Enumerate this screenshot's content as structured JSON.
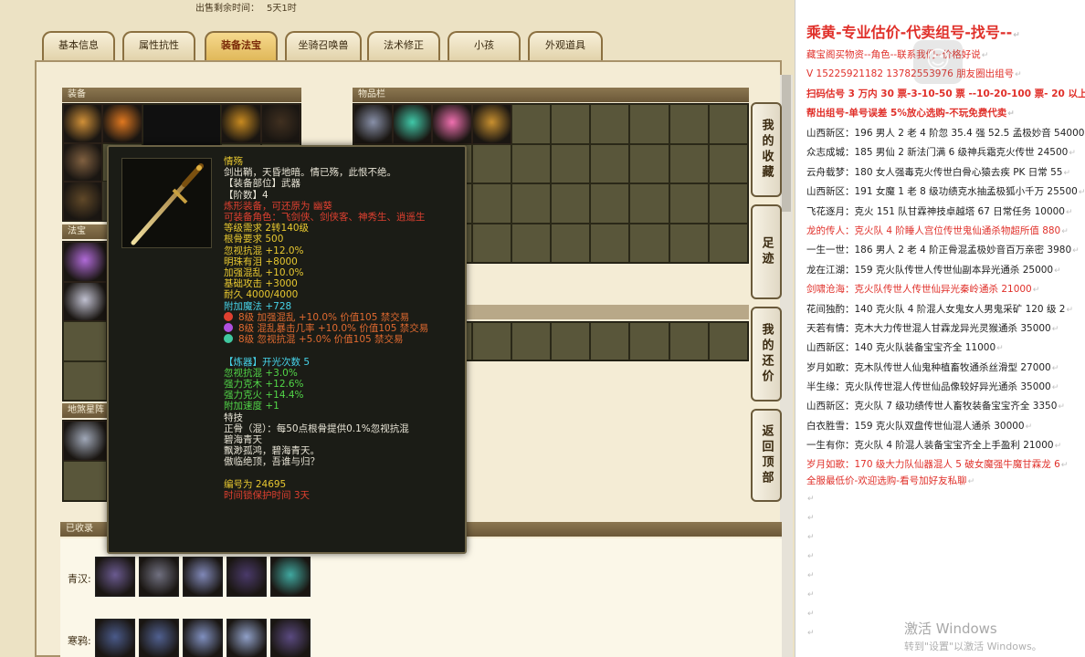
{
  "header": {
    "sale_time_label": "出售剩余时间：",
    "sale_time_value": "5天1时"
  },
  "tabs": [
    "基本信息",
    "属性抗性",
    "装备法宝",
    "坐骑召唤兽",
    "法术修正",
    "小孩",
    "外观道具"
  ],
  "active_tab": "装备法宝",
  "panels": {
    "equip": "装备",
    "inventory": "物品栏",
    "fabao": "法宝",
    "dijiang": "地煞星阵",
    "collected": "已收录"
  },
  "side_buttons": [
    "我的收藏",
    "足迹",
    "我的还价",
    "返回顶部"
  ],
  "collected_rows": [
    {
      "label": "青汉:"
    },
    {
      "label": "寒鸦:"
    }
  ],
  "tooltip": {
    "name": "情殇",
    "lines": [
      {
        "text": "剑出鞘，天昏地暗。情已殇，此恨不绝。",
        "color": "w"
      },
      {
        "text": "【装备部位】武器",
        "color": "w"
      },
      {
        "text": "【阶数】4",
        "color": "w"
      },
      {
        "text": "炼形装备，可还原为   幽葵",
        "color": "r"
      },
      {
        "text": "可装备角色：飞剑侠、剑侠客、神秀生、逍遥生",
        "color": "r"
      },
      {
        "text": "等级需求 2转140级",
        "color": "y"
      },
      {
        "text": "根骨要求 500",
        "color": "y"
      },
      {
        "text": "忽视抗混 +12.0%",
        "color": "y"
      },
      {
        "text": "明珠有泪 +8000",
        "color": "y"
      },
      {
        "text": "加强混乱 +10.0%",
        "color": "y"
      },
      {
        "text": "基础攻击 +3000",
        "color": "y"
      },
      {
        "text": "耐久 4000/4000",
        "color": "y"
      },
      {
        "text": "附加魔法 +728",
        "color": "c"
      },
      {
        "text": "8级 加强混乱 +10.0% 价值105 禁交易",
        "color": "o",
        "gem": "#e04030"
      },
      {
        "text": "8级 混乱暴击几率 +10.0% 价值105 禁交易",
        "color": "o",
        "gem": "#b050e0"
      },
      {
        "text": "8级 忽视抗混 +5.0% 价值105 禁交易",
        "color": "o",
        "gem": "#40c8a0"
      },
      {
        "text": "",
        "color": "w"
      },
      {
        "text": "【炼器】开光次数 5",
        "color": "c"
      },
      {
        "text": "忽视抗混 +3.0%",
        "color": "g"
      },
      {
        "text": "强力克木 +12.6%",
        "color": "g"
      },
      {
        "text": "强力克火 +14.4%",
        "color": "g"
      },
      {
        "text": "附加速度 +1",
        "color": "g"
      },
      {
        "text": "特技",
        "color": "w"
      },
      {
        "text": "正骨（混）：每50点根骨提供0.1%忽视抗混",
        "color": "w"
      },
      {
        "text": "碧海青天",
        "color": "w"
      },
      {
        "text": "飘渺孤鸿，碧海青天。",
        "color": "w"
      },
      {
        "text": "傲临绝顶，吾谁与归？",
        "color": "w"
      },
      {
        "text": "",
        "color": "w"
      },
      {
        "text": "编号为 24695",
        "color": "y"
      },
      {
        "text": "时间锁保护时间   3天",
        "color": "r"
      }
    ]
  },
  "doc": {
    "lines": [
      {
        "text": "乘黄-专业估价-代卖组号-找号--",
        "style": "big"
      },
      {
        "text": "藏宝阁买物资--角色--联系我们--价格好说",
        "style": "red"
      },
      {
        "text": "V 15225921182   13782553976 朋友圈出组号",
        "style": "red"
      },
      {
        "text": "扫码估号 3 万内 30 票-3-10-50 票 --10-20-100 票- 20 以上 1",
        "style": "red bold"
      },
      {
        "text": "帮出组号-单号误差 5%放心选购-不玩免费代卖",
        "style": "red bold"
      },
      {
        "text": "山西新区：196 男人 2 老 4 阶忽 35.4 强 52.5 孟极妙音 54000",
        "style": ""
      },
      {
        "text": "众志成城：185 男仙 2 新法门满 6 级神兵霜克火传世 24500",
        "style": ""
      },
      {
        "text": "云舟载梦：180 女人强毒克火传世白骨心猿去疾 PK 日常 55",
        "style": ""
      },
      {
        "text": "山西新区：191 女魔 1 老 8 级功绩克水抽孟极狐小千万 25500",
        "style": ""
      },
      {
        "text": "飞花逐月：克火 151 队甘霖神技卓越塔 67 日常任务 10000",
        "style": ""
      },
      {
        "text": "龙的传人：克火队 4 阶睡人宫位传世鬼仙通杀物超所值 880",
        "style": "red"
      },
      {
        "text": "一生一世：186 男人 2 老 4 阶正骨混孟极妙音百万亲密 3980",
        "style": ""
      },
      {
        "text": "龙在江湖：159 克火队传世人传世仙副本异光通杀 25000",
        "style": ""
      },
      {
        "text": "剑啸沧海：克火队传世人传世仙异光秦岭通杀 21000",
        "style": "red"
      },
      {
        "text": "花间独酌：140 克火队 4 阶混人女鬼女人男鬼采矿 120 级 2",
        "style": ""
      },
      {
        "text": "天若有情：克木大力传世混人甘霖龙异光灵猴通杀 35000",
        "style": ""
      },
      {
        "text": "山西新区：140 克火队装备宝宝齐全 11000",
        "style": ""
      },
      {
        "text": "岁月如歌：克木队传世人仙鬼种植畜牧通杀丝滑型 27000",
        "style": ""
      },
      {
        "text": "半生缘：克火队传世混人传世仙品像较好异光通杀 35000",
        "style": ""
      },
      {
        "text": "山西新区：克火队 7 级功绩传世人畜牧装备宝宝齐全 3350",
        "style": ""
      },
      {
        "text": "白衣胜雪：159 克火队双盘传世仙混人通杀 30000",
        "style": ""
      },
      {
        "text": "一生有你：克火队 4 阶混人装备宝宝齐全上手盈利 21000",
        "style": ""
      },
      {
        "text": "岁月如歌：170 级大力队仙器混人 5 破女魔强牛魔甘霖龙 6",
        "style": "red"
      },
      {
        "text": "全服最低价-欢迎选购-看号加好友私聊",
        "style": "red"
      }
    ],
    "return_mark": "↵"
  },
  "watermark": {
    "title": "激活 Windows",
    "subtitle": "转到\"设置\"以激活 Windows。"
  }
}
